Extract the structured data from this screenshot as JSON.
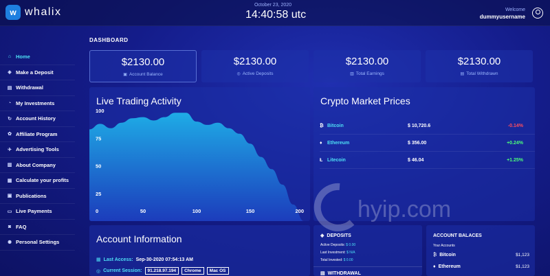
{
  "brand": {
    "icon_letter": "w",
    "name": "whalix"
  },
  "header": {
    "date": "October 23, 2020",
    "time": "14:40:58 utc",
    "welcome": "Welcome",
    "username": "dummyusername"
  },
  "sidebar": {
    "items": [
      {
        "label": "Home",
        "icon": "home-icon",
        "glyph": "⌂",
        "active": true
      },
      {
        "label": "Make a Deposit",
        "icon": "deposit-icon",
        "glyph": "◈"
      },
      {
        "label": "Withdrawal",
        "icon": "withdrawal-icon",
        "glyph": "▤"
      },
      {
        "label": "My Investments",
        "icon": "investments-icon",
        "glyph": "◔"
      },
      {
        "label": "Account History",
        "icon": "history-icon",
        "glyph": "↻"
      },
      {
        "label": "Affiliate Program",
        "icon": "affiliate-icon",
        "glyph": "✿"
      },
      {
        "label": "Advertising Tools",
        "icon": "advertising-icon",
        "glyph": "✈"
      },
      {
        "label": "About Company",
        "icon": "company-icon",
        "glyph": "▥"
      },
      {
        "label": "Calculate your profits",
        "icon": "calculator-icon",
        "glyph": "▦"
      },
      {
        "label": "Publications",
        "icon": "publications-icon",
        "glyph": "▣"
      },
      {
        "label": "Live Payments",
        "icon": "payments-icon",
        "glyph": "▭"
      },
      {
        "label": "FAQ",
        "icon": "faq-icon",
        "glyph": "◙"
      },
      {
        "label": "Personal Settings",
        "icon": "settings-icon",
        "glyph": "✺"
      }
    ]
  },
  "dashboard": {
    "title": "DASHBOARD",
    "cards": [
      {
        "amount": "$2130.00",
        "label": "Account Balance",
        "icon": "wallet-icon",
        "glyph": "▣"
      },
      {
        "amount": "$2130.00",
        "label": "Active Deposits",
        "icon": "coins-icon",
        "glyph": "◎"
      },
      {
        "amount": "$2130.00",
        "label": "Total Earnings",
        "icon": "chart-icon",
        "glyph": "▥"
      },
      {
        "amount": "$2130.00",
        "label": "Total Withdrawn",
        "icon": "withdraw-icon",
        "glyph": "▤"
      }
    ]
  },
  "trading": {
    "title": "Live Trading Activity"
  },
  "chart_data": {
    "type": "area",
    "x": [
      0,
      10,
      20,
      30,
      40,
      50,
      60,
      70,
      80,
      90,
      100,
      110,
      120,
      130,
      140,
      150,
      160,
      170,
      180,
      190,
      200
    ],
    "values": [
      83,
      88,
      84,
      89,
      93,
      94,
      91,
      94,
      98,
      98,
      90,
      87,
      89,
      84,
      79,
      70,
      58,
      47,
      33,
      15,
      0
    ],
    "xlim": [
      0,
      200
    ],
    "ylim": [
      0,
      100
    ],
    "x_ticks": [
      0,
      50,
      100,
      150,
      200
    ],
    "y_ticks": [
      25,
      50,
      75,
      100
    ],
    "color": "#1fb3ea",
    "grid": false
  },
  "crypto": {
    "title": "Crypto Market Prices",
    "rows": [
      {
        "name": "Bitcoin",
        "glyph": "₿",
        "icon": "bitcoin-icon",
        "price": "$ 10,720.6",
        "change": "-0.14%",
        "dir": "down"
      },
      {
        "name": "Ethereum",
        "glyph": "♦",
        "icon": "ethereum-icon",
        "price": "$ 356.00",
        "change": "+0.24%",
        "dir": "up"
      },
      {
        "name": "Litecoin",
        "glyph": "Ł",
        "icon": "litecoin-icon",
        "price": "$ 46.04",
        "change": "+1.25%",
        "dir": "up"
      }
    ]
  },
  "account_info": {
    "title": "Account Information",
    "last_access_label": "Last Access:",
    "last_access_value": "Sep-30-2020 07:54:13 AM",
    "session_label": "Current Session:",
    "session_ip": "91.218.97.194",
    "session_browser": "Chrome",
    "session_os": "Mac OS"
  },
  "deposits": {
    "title": "DEPOSITS",
    "active_label": "Active Deposits:",
    "active_value": "$ 0.00",
    "last_label": "Last Investment:",
    "last_value": "$ N/A",
    "total_label": "Total Invested:",
    "total_value": "$ 0.00",
    "withdrawal_title": "WITHDRAWAL"
  },
  "balances": {
    "title": "ACCOUNT BALACES",
    "subtitle": "Your Accounts",
    "rows": [
      {
        "name": "Bitcoin",
        "glyph": "₿",
        "value": "$1,123"
      },
      {
        "name": "Ethereum",
        "glyph": "♦",
        "value": "$1,123"
      }
    ]
  },
  "watermark": {
    "text": "hyip.com"
  },
  "colors": {
    "accent": "#4ee0f5",
    "up": "#4cff7a",
    "down": "#ff4d5e",
    "area": "#1fb3ea"
  }
}
